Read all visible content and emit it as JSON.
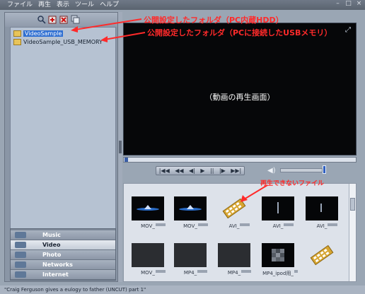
{
  "menu": [
    "ファイル",
    "再生",
    "表示",
    "ツール",
    "ヘルプ"
  ],
  "window_controls": [
    "–",
    "□",
    "×"
  ],
  "toolbar_icons": [
    "search-icon",
    "add-icon",
    "delete-icon",
    "copy-icon"
  ],
  "tree": [
    {
      "label": "VideoSample",
      "selected": true
    },
    {
      "label": "VideoSample_USB_MEMORY",
      "selected": false
    }
  ],
  "categories": [
    {
      "label": "Music",
      "icon": "music-icon",
      "active": false
    },
    {
      "label": "Video",
      "icon": "video-icon",
      "active": true
    },
    {
      "label": "Photo",
      "icon": "photo-icon",
      "active": false
    },
    {
      "label": "Networks",
      "icon": "networks-icon",
      "active": false
    },
    {
      "label": "Internet",
      "icon": "internet-icon",
      "active": false
    }
  ],
  "video": {
    "caption": "（動画の再生画面）"
  },
  "controls": [
    "|◀◀",
    "◀◀",
    "◀|",
    "▶",
    "||",
    "|▶",
    "▶▶|"
  ],
  "thumbnails": [
    {
      "caption": "MOV_",
      "kind": "logo"
    },
    {
      "caption": "MOV_",
      "kind": "logo"
    },
    {
      "caption": "AVI_",
      "kind": "unsupported"
    },
    {
      "caption": "AVI_",
      "kind": "dark"
    },
    {
      "caption": "AVI_",
      "kind": "dark"
    },
    {
      "caption": "MOV_",
      "kind": "gray"
    },
    {
      "caption": "MP4_",
      "kind": "gray"
    },
    {
      "caption": "MP4_",
      "kind": "gray"
    },
    {
      "caption": "MP4_ipod用_",
      "kind": "pixel"
    },
    {
      "caption": "",
      "kind": "unsupported"
    }
  ],
  "status": "\"Craig Ferguson gives a eulogy to father (UNCUT) part 1\"",
  "annotations": {
    "hdd": "公開設定したフォルダ（PC内蔵HDD）",
    "usb": "公開設定したフォルダ（PCに接続したUSBメモリ）",
    "unplayable": "再生できないファイル"
  },
  "colors": {
    "annotation": "#ff2a2a",
    "selection": "#2f6fd2",
    "accent": "#2f5fc0"
  }
}
